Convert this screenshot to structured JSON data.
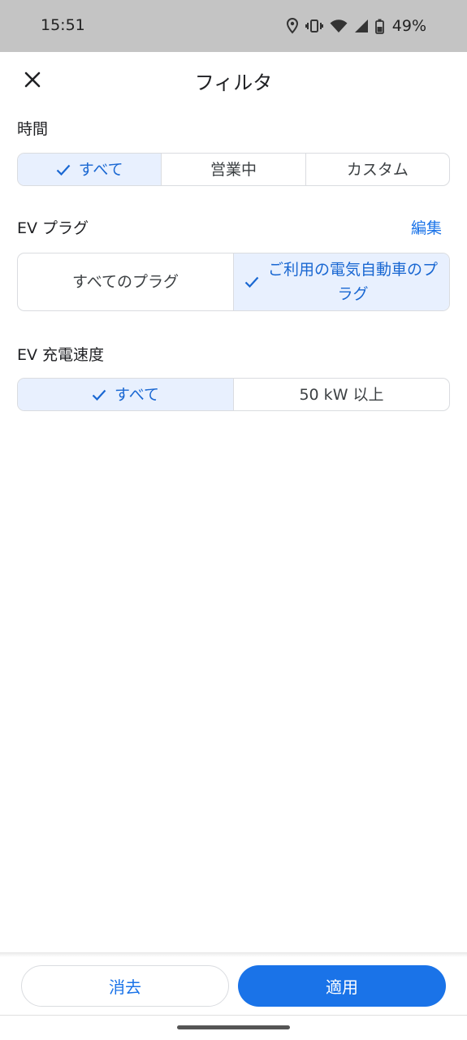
{
  "status_bar": {
    "time": "15:51",
    "battery": "49%",
    "icons": [
      "location-icon",
      "vibrate-icon",
      "wifi-icon",
      "signal-icon",
      "battery-icon"
    ]
  },
  "header": {
    "title": "フィルタ",
    "close_icon": "close-icon"
  },
  "sections": {
    "time": {
      "label": "時間",
      "options": [
        "すべて",
        "営業中",
        "カスタム"
      ],
      "selected": "すべて"
    },
    "plug": {
      "label": "EV プラグ",
      "edit_label": "編集",
      "options": [
        "すべてのプラグ",
        "ご利用の電気自動車のプラグ"
      ],
      "selected": "ご利用の電気自動車のプラグ"
    },
    "speed": {
      "label": "EV 充電速度",
      "options": [
        "すべて",
        "50 kW 以上"
      ],
      "selected": "すべて"
    }
  },
  "footer": {
    "clear_label": "消去",
    "apply_label": "適用"
  },
  "colors": {
    "accent": "#1a73e8",
    "selected_bg": "#e8f0fe",
    "status_bar_bg": "#c4c4c4"
  }
}
